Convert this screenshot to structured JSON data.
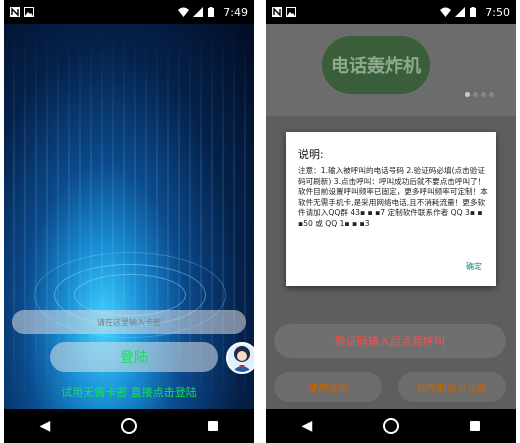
{
  "left_screen": {
    "status": {
      "time": "7:49"
    },
    "input": {
      "placeholder": "请在这里输入卡密"
    },
    "login_button": {
      "label": "登陆"
    },
    "trial_text": "试用无需卡密  直接点击登陆"
  },
  "right_screen": {
    "status": {
      "time": "7:50"
    },
    "banner": {
      "title": "电话轰炸机"
    },
    "dialog": {
      "title": "说明:",
      "body": "注意：1.输入被呼叫的电话号码 2.验证码必填(点击验证码可刷新) 3.点击呼叫：呼叫成功后就不要点击呼叫了！软件目前设置呼叫频率已固定，更多呼叫频率可定制！本软件无需手机卡,是采用网络电话,且不消耗流量！更多软件请加入QQ群 43▪ ▪ ▪7 定制软件联系作者 QQ 3▪ ▪ ▪50 或 QQ 1▪ ▪ ▪3",
      "ok_label": "确定"
    },
    "verify_button": {
      "label": "验证码输入后点我呼叫"
    },
    "bottom_buttons": [
      {
        "label": "使用说明"
      },
      {
        "label": "秒呼叫会员注册"
      }
    ]
  },
  "colors": {
    "login_green": "#17e05a",
    "verify_red": "#ff4d4d",
    "orange": "#c96500",
    "dialog_ok": "#1a8a7a"
  }
}
